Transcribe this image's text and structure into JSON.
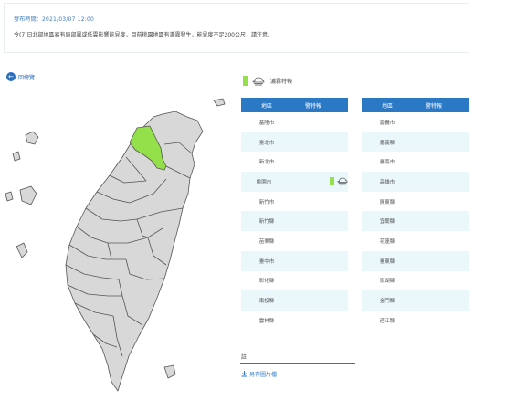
{
  "notice": {
    "time": "發布時間：2021/03/07 12:00",
    "message": "今(7)日北部地區易有局部霧或低雲影響能見度，目前桃園地區有濃霧發生，能見度不足200公尺，請注意。"
  },
  "back": {
    "icon": "arrow-left-icon",
    "label": "回總覽"
  },
  "legend": {
    "label": "濃霧特報",
    "icon": "fog-icon",
    "color": "#93e04a"
  },
  "table_left": {
    "headers": [
      "地區",
      "警特報"
    ],
    "rows": [
      {
        "area": "基隆市",
        "alert": ""
      },
      {
        "area": "臺北市",
        "alert": ""
      },
      {
        "area": "新北市",
        "alert": ""
      },
      {
        "area": "桃園市",
        "alert": "fog"
      },
      {
        "area": "新竹市",
        "alert": ""
      },
      {
        "area": "新竹縣",
        "alert": ""
      },
      {
        "area": "苗栗縣",
        "alert": ""
      },
      {
        "area": "臺中市",
        "alert": ""
      },
      {
        "area": "彰化縣",
        "alert": ""
      },
      {
        "area": "南投縣",
        "alert": ""
      },
      {
        "area": "雲林縣",
        "alert": ""
      }
    ]
  },
  "table_right": {
    "headers": [
      "地區",
      "警特報"
    ],
    "rows": [
      {
        "area": "嘉義市",
        "alert": ""
      },
      {
        "area": "嘉義縣",
        "alert": ""
      },
      {
        "area": "臺南市",
        "alert": ""
      },
      {
        "area": "高雄市",
        "alert": ""
      },
      {
        "area": "屏東縣",
        "alert": ""
      },
      {
        "area": "宜蘭縣",
        "alert": ""
      },
      {
        "area": "花蓮縣",
        "alert": ""
      },
      {
        "area": "臺東縣",
        "alert": ""
      },
      {
        "area": "澎湖縣",
        "alert": ""
      },
      {
        "area": "金門縣",
        "alert": ""
      },
      {
        "area": "連江縣",
        "alert": ""
      }
    ]
  },
  "note": {
    "label": "註"
  },
  "download": {
    "icon": "download-icon",
    "label": "另存圖片檔"
  },
  "colors": {
    "accent": "#2b78c5",
    "alert": "#93e04a",
    "land": "#d8d8d8",
    "row_alt": "#eaf8fc"
  }
}
